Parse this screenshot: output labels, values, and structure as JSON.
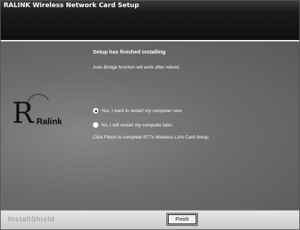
{
  "window": {
    "title": "RALINK Wireless Network Card Setup"
  },
  "logo": {
    "letter": "R",
    "brand": "Ralink"
  },
  "content": {
    "heading": "Setup has finished installing",
    "message": "Auto-Bridge function will work after reboot.",
    "options": [
      {
        "label": "Yes, I want to restart my computer now.",
        "selected": true
      },
      {
        "label": "No, I will restart my computer later.",
        "selected": false
      }
    ],
    "note": "Click Finish to complete RT7x Wireless LAN Card Setup."
  },
  "footer": {
    "installshield": "InstallShield",
    "finish_label": "Finish"
  },
  "colors": {
    "panel": "#6d6d6d",
    "header": "#141414",
    "footer": "#d6d6d6"
  }
}
